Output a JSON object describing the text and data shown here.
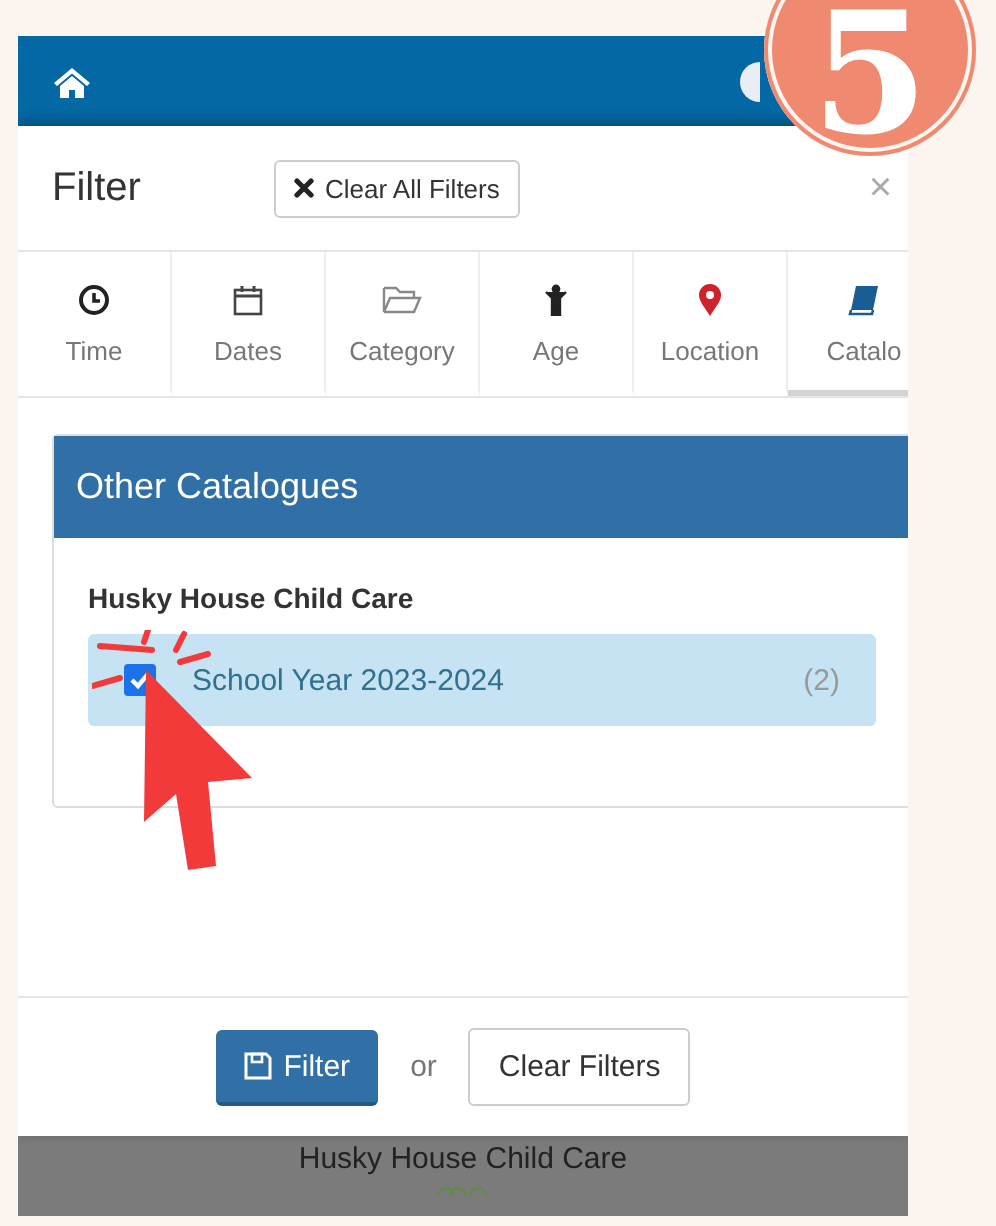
{
  "annotation": {
    "step": "5"
  },
  "modal": {
    "title": "Filter",
    "clear_all_button": "Clear All Filters",
    "close": "×",
    "tabs": [
      {
        "label": "Time",
        "selected": false
      },
      {
        "label": "Dates",
        "selected": false
      },
      {
        "label": "Category",
        "selected": false
      },
      {
        "label": "Age",
        "selected": false
      },
      {
        "label": "Location",
        "selected": false
      },
      {
        "label": "Catalo",
        "selected": true
      }
    ],
    "panel": {
      "title": "Other Catalogues",
      "group": "Husky House Child Care",
      "options": [
        {
          "label": "School Year 2023-2024",
          "count": "(2)",
          "checked": true
        }
      ]
    },
    "footer": {
      "filter_button": "Filter",
      "or": "or",
      "clear_button": "Clear Filters"
    }
  },
  "background": {
    "text": "Husky House Child Care"
  }
}
